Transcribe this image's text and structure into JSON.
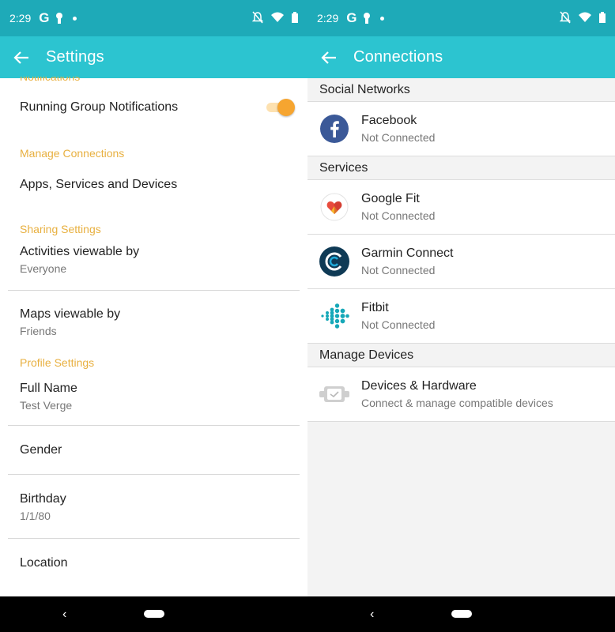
{
  "left": {
    "status": {
      "time": "2:29",
      "g": "G"
    },
    "title": "Settings",
    "partial_header": "Notifications",
    "running_group": "Running Group Notifications",
    "manage_connections_header": "Manage Connections",
    "apps_services_devices": "Apps, Services and Devices",
    "sharing_header": "Sharing Settings",
    "activities_label": "Activities viewable by",
    "activities_value": "Everyone",
    "maps_label": "Maps viewable by",
    "maps_value": "Friends",
    "profile_header": "Profile Settings",
    "full_name_label": "Full Name",
    "full_name_value": "Test Verge",
    "gender_label": "Gender",
    "birthday_label": "Birthday",
    "birthday_value": "1/1/80",
    "location_label": "Location"
  },
  "right": {
    "status": {
      "time": "2:29",
      "g": "G"
    },
    "title": "Connections",
    "social_header": "Social Networks",
    "facebook": {
      "name": "Facebook",
      "status": "Not Connected"
    },
    "services_header": "Services",
    "google_fit": {
      "name": "Google Fit",
      "status": "Not Connected"
    },
    "garmin": {
      "name": "Garmin Connect",
      "status": "Not Connected"
    },
    "fitbit": {
      "name": "Fitbit",
      "status": "Not Connected"
    },
    "manage_devices_header": "Manage Devices",
    "devices": {
      "name": "Devices & Hardware",
      "status": "Connect & manage compatible devices"
    }
  },
  "colors": {
    "statusbar": "#1eaab8",
    "appbar": "#2cc4d0",
    "section_header": "#e8b040",
    "toggle": "#f6a530"
  }
}
